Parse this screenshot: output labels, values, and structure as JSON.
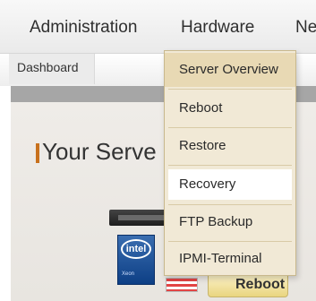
{
  "topnav": {
    "items": [
      "Administration",
      "Hardware",
      "Ne"
    ]
  },
  "subnav": {
    "tab_label": "Dashboard"
  },
  "content": {
    "heading": "Your Serve"
  },
  "hardware": {
    "intel_text": "intel",
    "xeon_text": "Xeon",
    "reboot_label": "Reboot"
  },
  "dropdown": {
    "items": [
      {
        "label": "Server Overview"
      },
      {
        "label": "Reboot"
      },
      {
        "label": "Restore"
      },
      {
        "label": "Recovery"
      },
      {
        "label": "FTP Backup"
      },
      {
        "label": "IPMI-Terminal"
      }
    ]
  },
  "colors": {
    "accent": "#c8711d",
    "menu_bg": "#f1e9d6",
    "menu_active": "#e8d9b4"
  }
}
